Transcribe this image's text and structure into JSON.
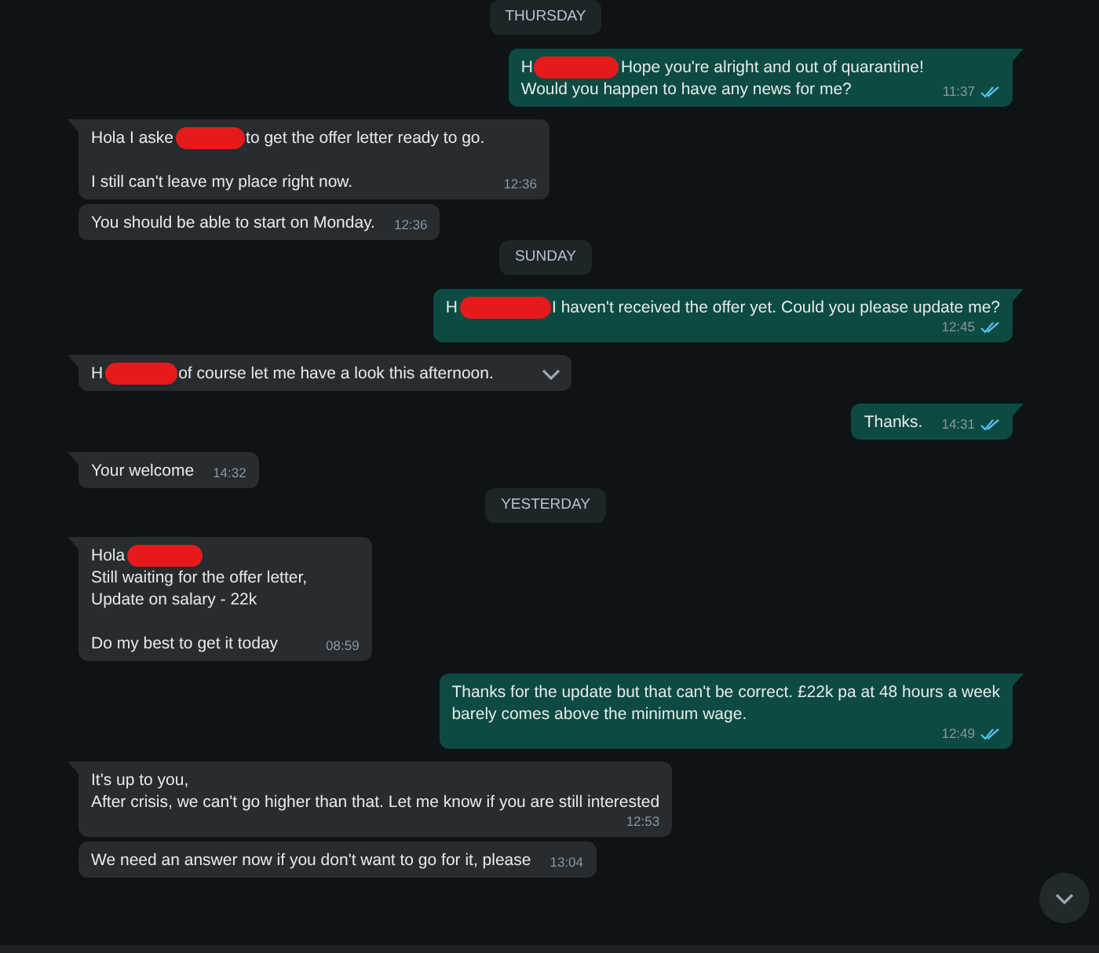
{
  "items": [
    {
      "kind": "date",
      "label": "THURSDAY"
    },
    {
      "kind": "outgoing",
      "paragraphs": [
        [
          [
            {
              "text": "H"
            },
            {
              "kind": "redaction"
            },
            {
              "text": "Hope you're alright and out of quarantine!"
            }
          ],
          [
            {
              "text": "Would you happen to have any news for me?"
            }
          ]
        ]
      ],
      "time": "11:37",
      "read": true,
      "hovered": false
    },
    {
      "kind": "incoming",
      "paragraphs": [
        [
          [
            {
              "text": "Hola I aske"
            },
            {
              "kind": "redaction"
            },
            {
              "text": "to get the offer letter ready to go."
            }
          ]
        ],
        [
          [
            {
              "text": "I still can't leave my place right now."
            }
          ]
        ]
      ],
      "time": "12:36",
      "hovered": false
    },
    {
      "kind": "incoming",
      "paragraphs": [
        [
          [
            {
              "text": "You should be able to start on Monday."
            }
          ]
        ]
      ],
      "time": "12:36",
      "hovered": false
    },
    {
      "kind": "date",
      "label": "SUNDAY"
    },
    {
      "kind": "outgoing",
      "paragraphs": [
        [
          [
            {
              "text": "H"
            },
            {
              "kind": "redaction"
            },
            {
              "text": "I haven't received the offer yet. Could you please update me?"
            }
          ]
        ]
      ],
      "time": "12:45",
      "read": true,
      "hovered": false,
      "time_below": true
    },
    {
      "kind": "incoming",
      "paragraphs": [
        [
          [
            {
              "text": "H"
            },
            {
              "kind": "redaction"
            },
            {
              "text": "of course let me have a look this afternoon."
            }
          ]
        ]
      ],
      "hovered": true
    },
    {
      "kind": "outgoing",
      "paragraphs": [
        [
          [
            {
              "text": "Thanks."
            }
          ]
        ]
      ],
      "time": "14:31",
      "read": true,
      "hovered": false
    },
    {
      "kind": "incoming",
      "paragraphs": [
        [
          [
            {
              "text": "Your welcome"
            }
          ]
        ]
      ],
      "time": "14:32",
      "hovered": false
    },
    {
      "kind": "date",
      "label": "YESTERDAY"
    },
    {
      "kind": "incoming",
      "paragraphs": [
        [
          [
            {
              "text": "Hola"
            },
            {
              "kind": "redaction"
            }
          ],
          [
            {
              "text": "Still waiting for the offer letter,"
            }
          ],
          [
            {
              "text": "Update on salary - 22k"
            }
          ]
        ],
        [
          [
            {
              "text": "Do my best to get it today"
            }
          ]
        ]
      ],
      "time": "08:59",
      "hovered": false
    },
    {
      "kind": "outgoing",
      "paragraphs": [
        [
          [
            {
              "text": "Thanks for the update but that can't be correct. £22k pa at 48 hours a week"
            }
          ],
          [
            {
              "text": "barely comes above the minimum wage."
            }
          ]
        ]
      ],
      "time": "12:49",
      "read": true,
      "hovered": false,
      "time_below": true
    },
    {
      "kind": "incoming",
      "paragraphs": [
        [
          [
            {
              "text": "It's up to you,"
            }
          ],
          [
            {
              "text": "After crisis, we can't go higher than that. Let me know if you are still interested"
            }
          ]
        ]
      ],
      "time": "12:53",
      "hovered": false,
      "time_below": true
    },
    {
      "kind": "incoming",
      "paragraphs": [
        [
          [
            {
              "text": "We need an answer now if you don't want to go for it, please"
            }
          ]
        ]
      ],
      "time": "13:04",
      "hovered": false
    }
  ]
}
